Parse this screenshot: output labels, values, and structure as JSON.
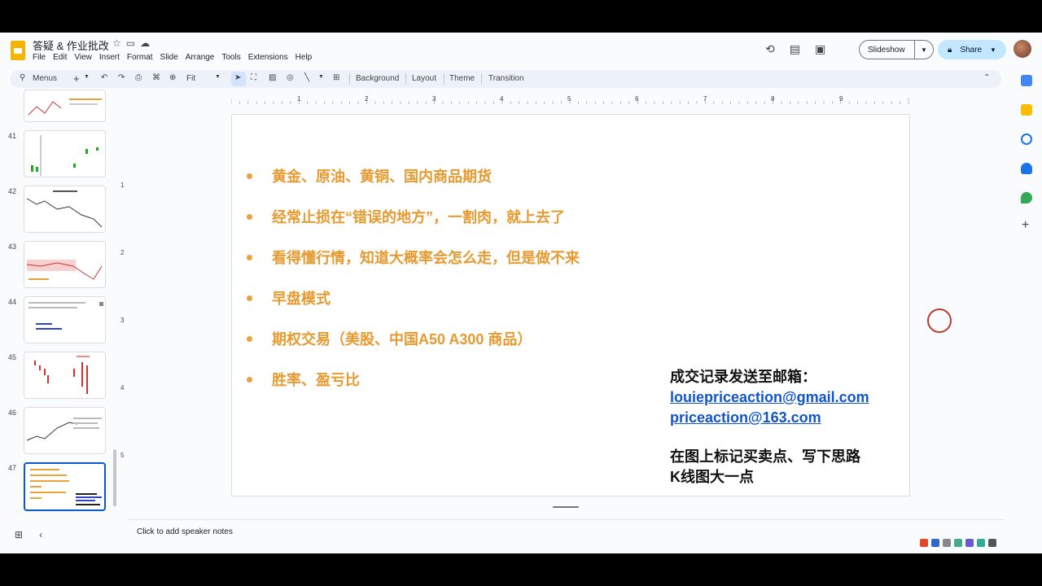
{
  "app": {
    "doc_title": "答疑 & 作业批改",
    "menu": [
      "File",
      "Edit",
      "View",
      "Insert",
      "Format",
      "Slide",
      "Arrange",
      "Tools",
      "Extensions",
      "Help"
    ],
    "slideshow_label": "Slideshow",
    "share_label": "Share"
  },
  "toolbar": {
    "menus_label": "Menus",
    "zoom_label": "Fit",
    "background_label": "Background",
    "layout_label": "Layout",
    "theme_label": "Theme",
    "transition_label": "Transition"
  },
  "filmstrip": {
    "slide_numbers": [
      "41",
      "42",
      "43",
      "44",
      "45",
      "46",
      "47"
    ],
    "selected": "47"
  },
  "ruler": {
    "h_ticks": [
      "1",
      "2",
      "3",
      "4",
      "5",
      "6",
      "7",
      "8",
      "9"
    ],
    "v_ticks": [
      "1",
      "2",
      "3",
      "4",
      "5"
    ]
  },
  "slide": {
    "bullets": [
      "黄金、原油、黄铜、国内商品期货",
      "经常止损在“错误的地方”，一割肉，就上去了",
      "看得懂行情，知道大概率会怎么走，但是做不来",
      "早盘模式",
      "期权交易（美股、中国A50 A300 商品）",
      "胜率、盈亏比"
    ],
    "contact_heading": "成交记录发送至邮箱：",
    "email1": "louiepriceaction@gmail.com",
    "email2": "priceaction@163.com",
    "note_line1": "在图上标记买卖点、写下思路",
    "note_line2": "K线图大一点"
  },
  "notes": {
    "placeholder": "Click to add speaker notes"
  },
  "colors": {
    "bullet_text": "#e69a30",
    "link": "#1155cc",
    "selection": "#0b57d0"
  }
}
